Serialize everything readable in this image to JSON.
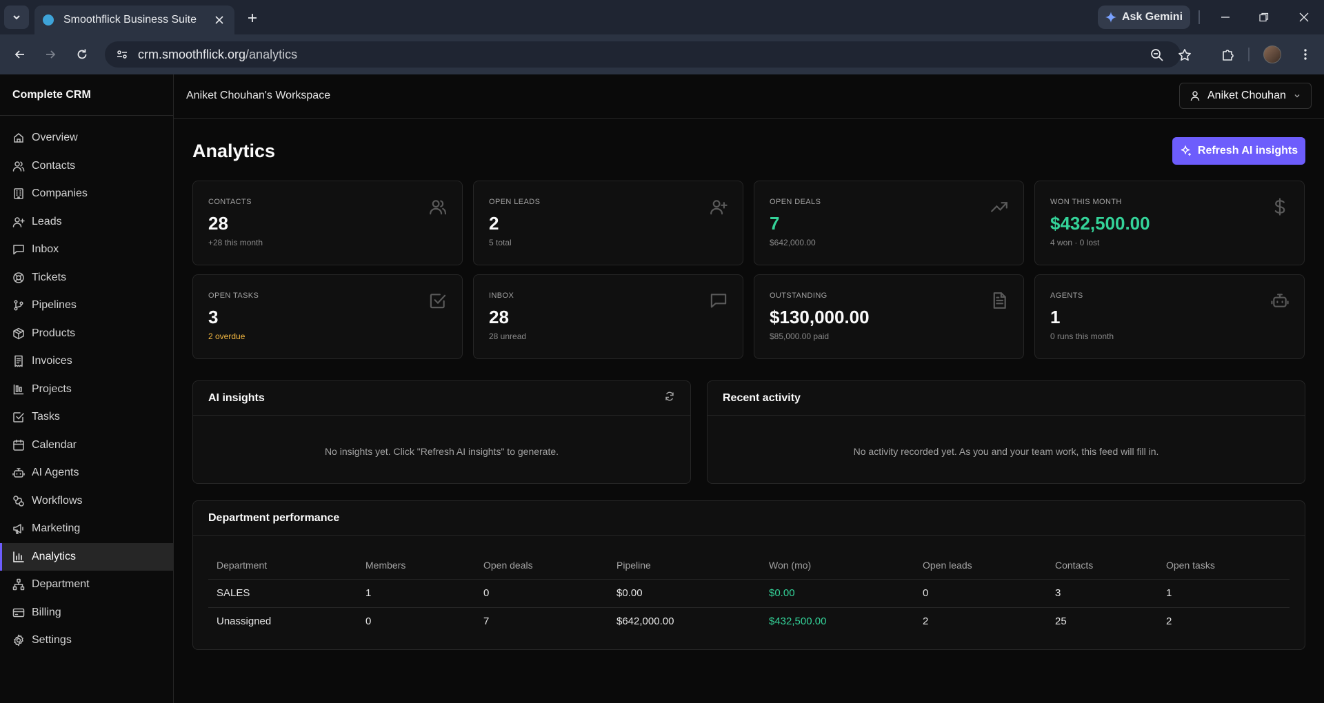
{
  "browser": {
    "tab_title": "Smoothflick Business Suite",
    "gemini_label": "Ask Gemini",
    "url_domain": "crm.smoothflick.org",
    "url_path": "/analytics"
  },
  "sidebar": {
    "brand": "Complete CRM",
    "items": [
      {
        "label": "Overview",
        "icon": "home-icon"
      },
      {
        "label": "Contacts",
        "icon": "users-icon"
      },
      {
        "label": "Companies",
        "icon": "building-icon"
      },
      {
        "label": "Leads",
        "icon": "user-plus-icon"
      },
      {
        "label": "Inbox",
        "icon": "message-icon"
      },
      {
        "label": "Tickets",
        "icon": "lifebuoy-icon"
      },
      {
        "label": "Pipelines",
        "icon": "git-branch-icon"
      },
      {
        "label": "Products",
        "icon": "package-icon"
      },
      {
        "label": "Invoices",
        "icon": "receipt-icon"
      },
      {
        "label": "Projects",
        "icon": "kanban-icon"
      },
      {
        "label": "Tasks",
        "icon": "check-square-icon"
      },
      {
        "label": "Calendar",
        "icon": "calendar-icon"
      },
      {
        "label": "AI Agents",
        "icon": "bot-icon"
      },
      {
        "label": "Workflows",
        "icon": "workflow-icon"
      },
      {
        "label": "Marketing",
        "icon": "megaphone-icon"
      },
      {
        "label": "Analytics",
        "icon": "bar-chart-icon",
        "active": true
      },
      {
        "label": "Department",
        "icon": "network-icon"
      },
      {
        "label": "Billing",
        "icon": "credit-card-icon"
      },
      {
        "label": "Settings",
        "icon": "settings-icon"
      }
    ]
  },
  "header": {
    "workspace": "Aniket Chouhan's Workspace",
    "user_name": "Aniket Chouhan"
  },
  "page": {
    "title": "Analytics",
    "refresh_label": "Refresh AI insights"
  },
  "stats": [
    {
      "label": "Contacts",
      "value": "28",
      "sub": "+28 this month",
      "icon": "users-icon"
    },
    {
      "label": "Open leads",
      "value": "2",
      "sub": "5 total",
      "icon": "user-plus-icon"
    },
    {
      "label": "Open deals",
      "value": "7",
      "sub": "$642,000.00",
      "icon": "trending-up-icon",
      "value_color": "green"
    },
    {
      "label": "Won this month",
      "value": "$432,500.00",
      "sub": "4 won · 0 lost",
      "icon": "dollar-icon",
      "value_color": "green"
    },
    {
      "label": "Open tasks",
      "value": "3",
      "sub": "2 overdue",
      "icon": "check-square-icon",
      "sub_color": "warn"
    },
    {
      "label": "Inbox",
      "value": "28",
      "sub": "28 unread",
      "icon": "message-icon"
    },
    {
      "label": "Outstanding",
      "value": "$130,000.00",
      "sub": "$85,000.00 paid",
      "icon": "file-icon"
    },
    {
      "label": "Agents",
      "value": "1",
      "sub": "0 runs this month",
      "icon": "bot-icon"
    }
  ],
  "ai_insights": {
    "title": "AI insights",
    "empty": "No insights yet. Click \"Refresh AI insights\" to generate."
  },
  "recent_activity": {
    "title": "Recent activity",
    "empty": "No activity recorded yet. As you and your team work, this feed will fill in."
  },
  "departments": {
    "title": "Department performance",
    "columns": [
      "Department",
      "Members",
      "Open deals",
      "Pipeline",
      "Won (mo)",
      "Open leads",
      "Contacts",
      "Open tasks"
    ],
    "rows": [
      [
        "SALES",
        "1",
        "0",
        "$0.00",
        "$0.00",
        "0",
        "3",
        "1"
      ],
      [
        "Unassigned",
        "0",
        "7",
        "$642,000.00",
        "$432,500.00",
        "2",
        "25",
        "2"
      ]
    ]
  },
  "colors": {
    "accent": "#6d5dfc",
    "positive": "#34d399",
    "warning": "#f5b942"
  }
}
